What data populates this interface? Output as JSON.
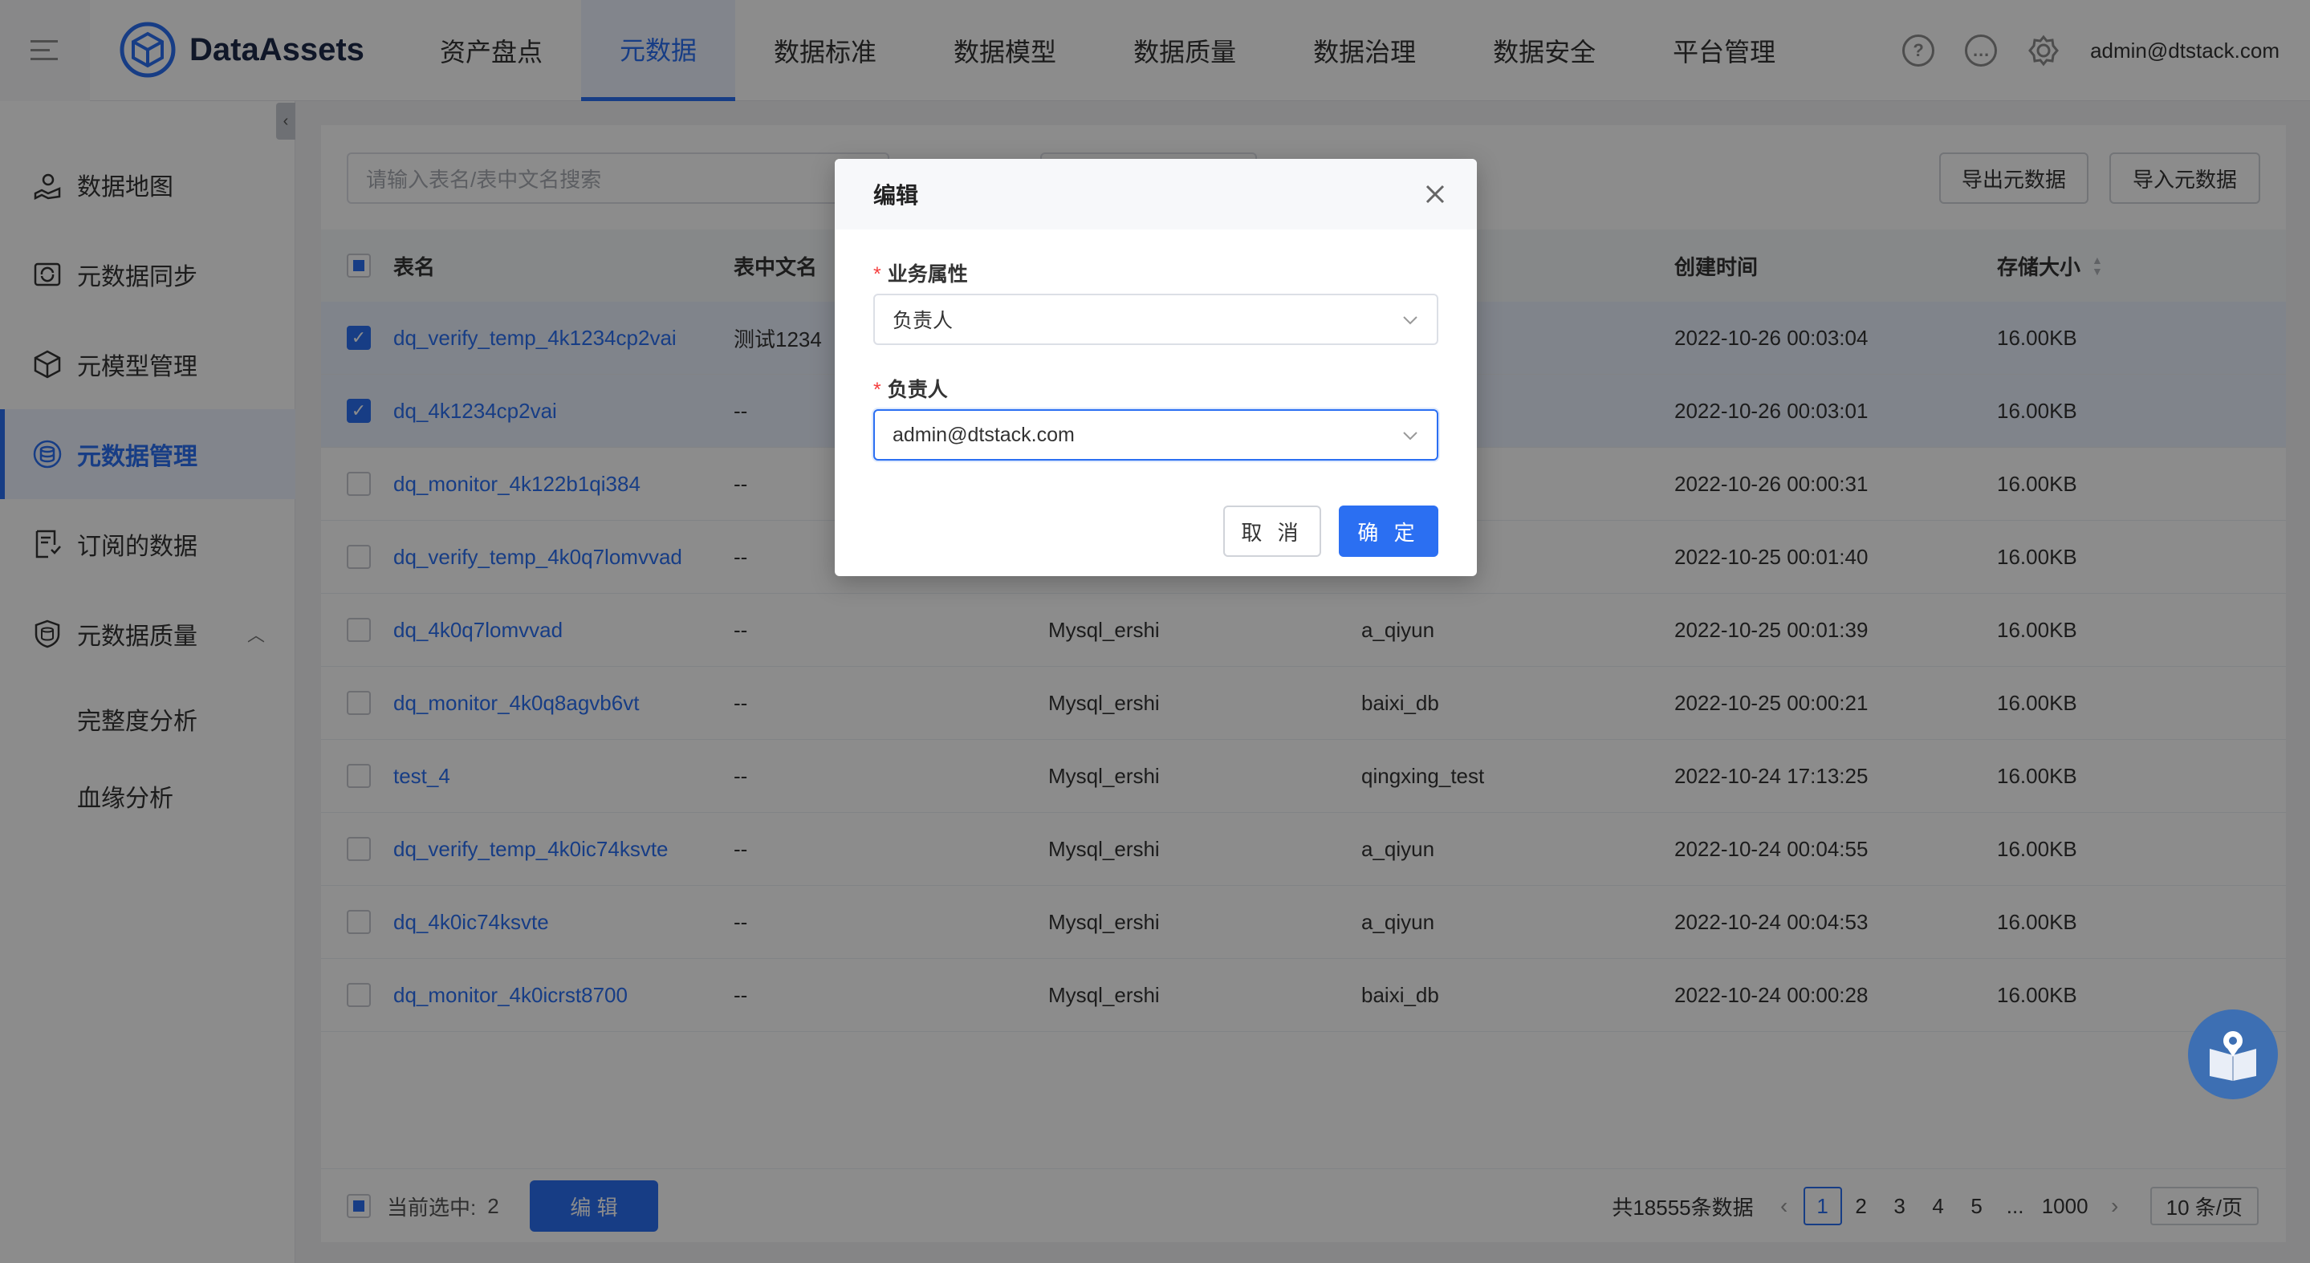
{
  "app": {
    "name": "DataAssets"
  },
  "top_nav": [
    "资产盘点",
    "元数据",
    "数据标准",
    "数据模型",
    "数据质量",
    "数据治理",
    "数据安全",
    "平台管理"
  ],
  "top_nav_active": "元数据",
  "header": {
    "user": "admin@dtstack.com",
    "icons": [
      "help-icon",
      "message-icon",
      "settings-icon"
    ]
  },
  "sidebar": {
    "items": [
      {
        "label": "数据地图",
        "icon": "map-icon"
      },
      {
        "label": "元数据同步",
        "icon": "sync-icon"
      },
      {
        "label": "元模型管理",
        "icon": "cube-icon"
      },
      {
        "label": "元数据管理",
        "icon": "database-icon",
        "active": true
      },
      {
        "label": "订阅的数据",
        "icon": "subscribe-icon"
      },
      {
        "label": "元数据质量",
        "icon": "shield-icon",
        "expanded": true
      }
    ],
    "sub_items": [
      "完整度分析",
      "血缘分析"
    ]
  },
  "toolbar": {
    "search_placeholder": "请输入表名/表中文名搜索",
    "export_label": "导出元数据",
    "import_label": "导入元数据"
  },
  "table": {
    "columns": {
      "name": "表名",
      "cn_name": "表中文名",
      "created": "创建时间",
      "size": "存储大小"
    },
    "rows": [
      {
        "name": "dq_verify_temp_4k1234cp2vai",
        "cn_name": "测试1234",
        "source": "",
        "db": "",
        "created": "2022-10-26 00:03:04",
        "size": "16.00KB",
        "checked": true
      },
      {
        "name": "dq_4k1234cp2vai",
        "cn_name": "--",
        "source": "",
        "db": "",
        "created": "2022-10-26 00:03:01",
        "size": "16.00KB",
        "checked": true
      },
      {
        "name": "dq_monitor_4k122b1qi384",
        "cn_name": "--",
        "source": "",
        "db": "",
        "created": "2022-10-26 00:00:31",
        "size": "16.00KB",
        "checked": false
      },
      {
        "name": "dq_verify_temp_4k0q7lomvvad",
        "cn_name": "--",
        "source": "",
        "db": "",
        "created": "2022-10-25 00:01:40",
        "size": "16.00KB",
        "checked": false
      },
      {
        "name": "dq_4k0q7lomvvad",
        "cn_name": "--",
        "source": "Mysql_ershi",
        "db": "a_qiyun",
        "created": "2022-10-25 00:01:39",
        "size": "16.00KB",
        "checked": false
      },
      {
        "name": "dq_monitor_4k0q8agvb6vt",
        "cn_name": "--",
        "source": "Mysql_ershi",
        "db": "baixi_db",
        "created": "2022-10-25 00:00:21",
        "size": "16.00KB",
        "checked": false
      },
      {
        "name": "test_4",
        "cn_name": "--",
        "source": "Mysql_ershi",
        "db": "qingxing_test",
        "created": "2022-10-24 17:13:25",
        "size": "16.00KB",
        "checked": false
      },
      {
        "name": "dq_verify_temp_4k0ic74ksvte",
        "cn_name": "--",
        "source": "Mysql_ershi",
        "db": "a_qiyun",
        "created": "2022-10-24 00:04:55",
        "size": "16.00KB",
        "checked": false
      },
      {
        "name": "dq_4k0ic74ksvte",
        "cn_name": "--",
        "source": "Mysql_ershi",
        "db": "a_qiyun",
        "created": "2022-10-24 00:04:53",
        "size": "16.00KB",
        "checked": false
      },
      {
        "name": "dq_monitor_4k0icrst8700",
        "cn_name": "--",
        "source": "Mysql_ershi",
        "db": "baixi_db",
        "created": "2022-10-24 00:00:28",
        "size": "16.00KB",
        "checked": false
      }
    ]
  },
  "footer": {
    "selected_label": "当前选中:",
    "selected_count": "2",
    "edit_button": "编 辑",
    "total": "共18555条数据",
    "pages": [
      "1",
      "2",
      "3",
      "4",
      "5",
      "...",
      "1000"
    ],
    "current_page": "1",
    "page_size": "10 条/页"
  },
  "modal": {
    "title": "编辑",
    "field1_label": "业务属性",
    "field1_value": "负责人",
    "field2_label": "负责人",
    "field2_value": "admin@dtstack.com",
    "cancel": "取 消",
    "ok": "确 定"
  }
}
